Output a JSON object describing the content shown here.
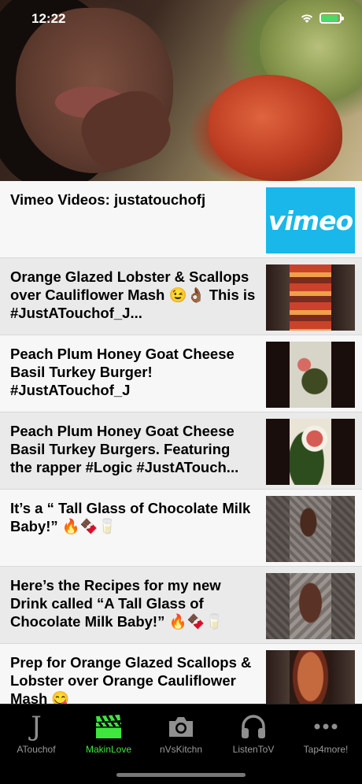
{
  "status_bar": {
    "time": "12:22"
  },
  "videos": [
    {
      "title": "Vimeo Videos: justatouchofj",
      "thumb": "vimeo",
      "thumb_text": "vimeo"
    },
    {
      "title": "Orange Glazed Lobster & Scallops over Cauliflower Mash 😉👌🏾 This is #JustATouchof_J...",
      "thumb": "t1"
    },
    {
      "title": "Peach Plum Honey Goat Cheese Basil Turkey Burger! #JustATouchof_J",
      "thumb": "t2"
    },
    {
      "title": "Peach Plum Honey Goat Cheese Basil Turkey Burgers. Featuring the rapper #Logic #JustATouch...",
      "thumb": "t3"
    },
    {
      "title": "It’s a “ Tall Glass of Chocolate Milk Baby!” 🔥🍫🥛",
      "thumb": "t4"
    },
    {
      "title": "Here’s the Recipes for my new Drink called “A Tall Glass of Chocolate Milk Baby!” 🔥🍫🥛",
      "thumb": "t5"
    },
    {
      "title": "Prep for Orange Glazed Scallops & Lobster over Orange Cauliflower Mash 😋",
      "thumb": "t6"
    }
  ],
  "tabs": [
    {
      "label": "ATouchof",
      "icon": "j-letter-icon",
      "active": false
    },
    {
      "label": "MakinLove",
      "icon": "clapperboard-icon",
      "active": true
    },
    {
      "label": "nVsKitchn",
      "icon": "camera-icon",
      "active": false
    },
    {
      "label": "ListenToV",
      "icon": "headphones-icon",
      "active": false
    },
    {
      "label": "Tap4more!",
      "icon": "more-dots-icon",
      "active": false
    }
  ],
  "colors": {
    "active_tab": "#3ee63e",
    "inactive_tab": "#9a9a9a",
    "vimeo_blue": "#19b7ea"
  }
}
